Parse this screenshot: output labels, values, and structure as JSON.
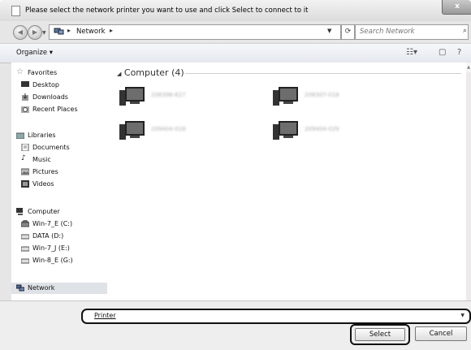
{
  "window": {
    "title": "Please select the network printer you want to use and click Select to connect to it",
    "close_label": "x"
  },
  "address_bar": {
    "path": [
      "Network"
    ],
    "separator": "▸",
    "search_placeholder": "Search Network"
  },
  "toolbar": {
    "organize_label": "Organize ▾"
  },
  "sidebar": {
    "items": [
      {
        "label": "Favorites",
        "icon": "star-icon"
      },
      {
        "label": "Desktop",
        "icon": "desktop-icon"
      },
      {
        "label": "Downloads",
        "icon": "downloads-icon"
      },
      {
        "label": "Recent Places",
        "icon": "recent-places-icon"
      },
      {
        "label": "Libraries",
        "icon": "libraries-icon"
      },
      {
        "label": "Documents",
        "icon": "documents-icon"
      },
      {
        "label": "Music",
        "icon": "music-icon"
      },
      {
        "label": "Pictures",
        "icon": "pictures-icon"
      },
      {
        "label": "Videos",
        "icon": "videos-icon"
      },
      {
        "label": "Computer",
        "icon": "computer-icon"
      },
      {
        "label": "Win-7_E (C:)",
        "icon": "drive-icon"
      },
      {
        "label": "DATA (D:)",
        "icon": "drive-icon"
      },
      {
        "label": "Win-7_J (E:)",
        "icon": "drive-icon"
      },
      {
        "label": "Win-8_E (G:)",
        "icon": "drive-icon"
      },
      {
        "label": "Network",
        "icon": "network-icon"
      }
    ]
  },
  "content": {
    "group_header": "Computer (4)",
    "computers": [
      {
        "name": "208396-627"
      },
      {
        "name": "208307-018"
      },
      {
        "name": "209404-018"
      },
      {
        "name": "209404-029"
      }
    ]
  },
  "footer": {
    "printer_label": "Printer",
    "select_label": "Select",
    "cancel_label": "Cancel"
  }
}
